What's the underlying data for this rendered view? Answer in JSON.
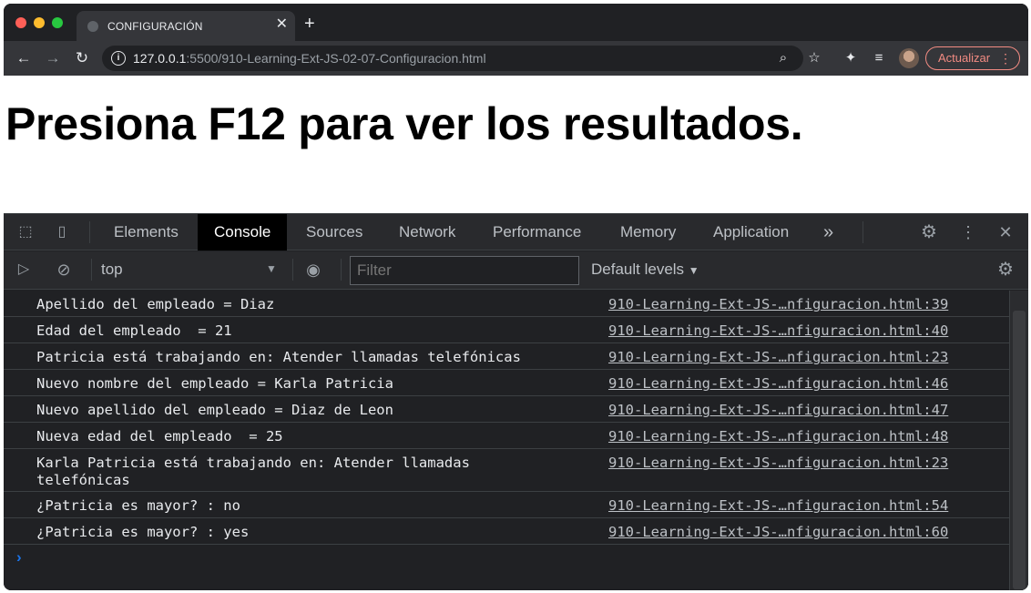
{
  "browser": {
    "tab_title": "CONFIGURACIÓN",
    "tab_close": "✕",
    "new_tab": "+",
    "url_host": "127.0.0.1",
    "url_rest": ":5500/910-Learning-Ext-JS-02-07-Configuracion.html",
    "update_label": "Actualizar"
  },
  "page": {
    "heading": "Presiona F12 para ver los resultados."
  },
  "devtools": {
    "tabs": [
      "Elements",
      "Console",
      "Sources",
      "Network",
      "Performance",
      "Memory",
      "Application"
    ],
    "active_tab": "Console",
    "more_tabs": "»",
    "context": "top",
    "filter_placeholder": "Filter",
    "levels": "Default levels"
  },
  "console": {
    "rows": [
      {
        "msg": "Apellido del empleado = Diaz",
        "src": "910-Learning-Ext-JS-…nfiguracion.html:39"
      },
      {
        "msg": "Edad del empleado  = 21",
        "src": "910-Learning-Ext-JS-…nfiguracion.html:40"
      },
      {
        "msg": "Patricia está trabajando en: Atender llamadas telefónicas",
        "src": "910-Learning-Ext-JS-…nfiguracion.html:23"
      },
      {
        "msg": "Nuevo nombre del empleado = Karla Patricia",
        "src": "910-Learning-Ext-JS-…nfiguracion.html:46"
      },
      {
        "msg": "Nuevo apellido del empleado = Diaz de Leon",
        "src": "910-Learning-Ext-JS-…nfiguracion.html:47"
      },
      {
        "msg": "Nueva edad del empleado  = 25",
        "src": "910-Learning-Ext-JS-…nfiguracion.html:48"
      },
      {
        "msg": "Karla Patricia está trabajando en: Atender llamadas\ntelefónicas",
        "src": "910-Learning-Ext-JS-…nfiguracion.html:23"
      },
      {
        "msg": "¿Patricia es mayor? : no",
        "src": "910-Learning-Ext-JS-…nfiguracion.html:54"
      },
      {
        "msg": "¿Patricia es mayor? : yes",
        "src": "910-Learning-Ext-JS-…nfiguracion.html:60"
      }
    ],
    "prompt_caret": "›"
  },
  "colors": {
    "chrome_dark": "#202124",
    "toolbar": "#35363a",
    "accent_update": "#f28b82",
    "console_prompt": "#1a73e8"
  }
}
